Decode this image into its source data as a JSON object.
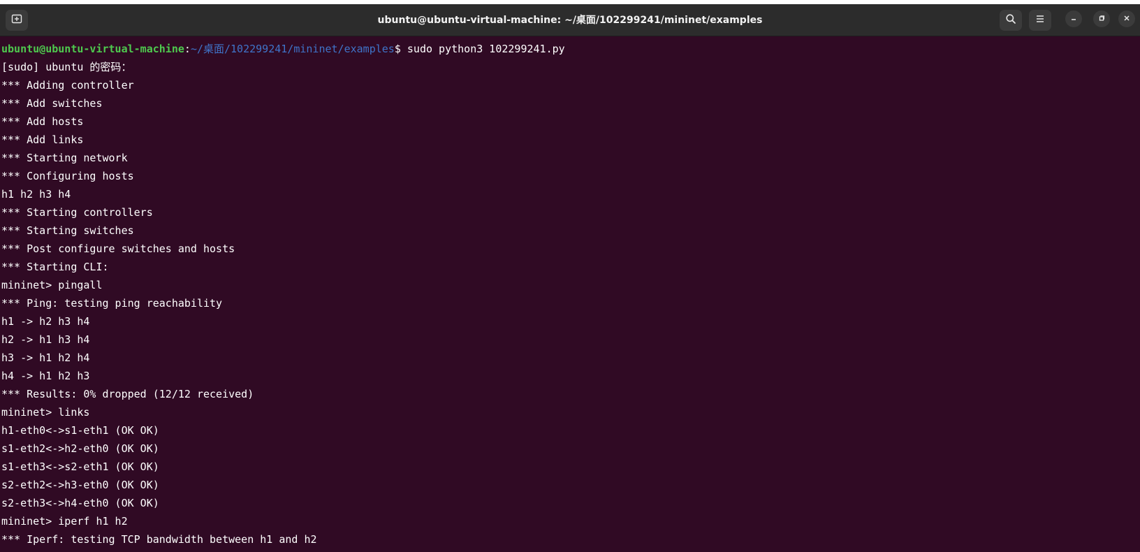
{
  "window": {
    "title": "ubuntu@ubuntu-virtual-machine: ~/桌面/102299241/mininet/examples",
    "buttons": {
      "new_tab": "new-tab-icon",
      "search": "search-icon",
      "menu": "hamburger-menu-icon",
      "minimize": "minimize-icon",
      "maximize": "maximize-icon",
      "close": "close-icon"
    }
  },
  "colors": {
    "background": "#300a24",
    "titlebar": "#2c2c2c",
    "prompt_user": "#4ec94e",
    "prompt_path": "#3f74c9",
    "text": "#ffffff"
  },
  "prompt": {
    "user_host": "ubuntu@ubuntu-virtual-machine",
    "colon": ":",
    "path": "~/桌面/102299241/mininet/examples",
    "dollar": "$",
    "command": " sudo python3 102299241.py"
  },
  "output_lines": [
    "[sudo] ubuntu 的密码：",
    "*** Adding controller",
    "*** Add switches",
    "*** Add hosts",
    "*** Add links",
    "*** Starting network",
    "*** Configuring hosts",
    "h1 h2 h3 h4",
    "*** Starting controllers",
    "*** Starting switches",
    "*** Post configure switches and hosts",
    "*** Starting CLI:",
    "mininet> pingall",
    "*** Ping: testing ping reachability",
    "h1 -> h2 h3 h4",
    "h2 -> h1 h3 h4",
    "h3 -> h1 h2 h4",
    "h4 -> h1 h2 h3",
    "*** Results: 0% dropped (12/12 received)",
    "mininet> links",
    "h1-eth0<->s1-eth1 (OK OK)",
    "s1-eth2<->h2-eth0 (OK OK)",
    "s1-eth3<->s2-eth1 (OK OK)",
    "s2-eth2<->h3-eth0 (OK OK)",
    "s2-eth3<->h4-eth0 (OK OK)",
    "mininet> iperf h1 h2",
    "*** Iperf: testing TCP bandwidth between h1 and h2"
  ]
}
